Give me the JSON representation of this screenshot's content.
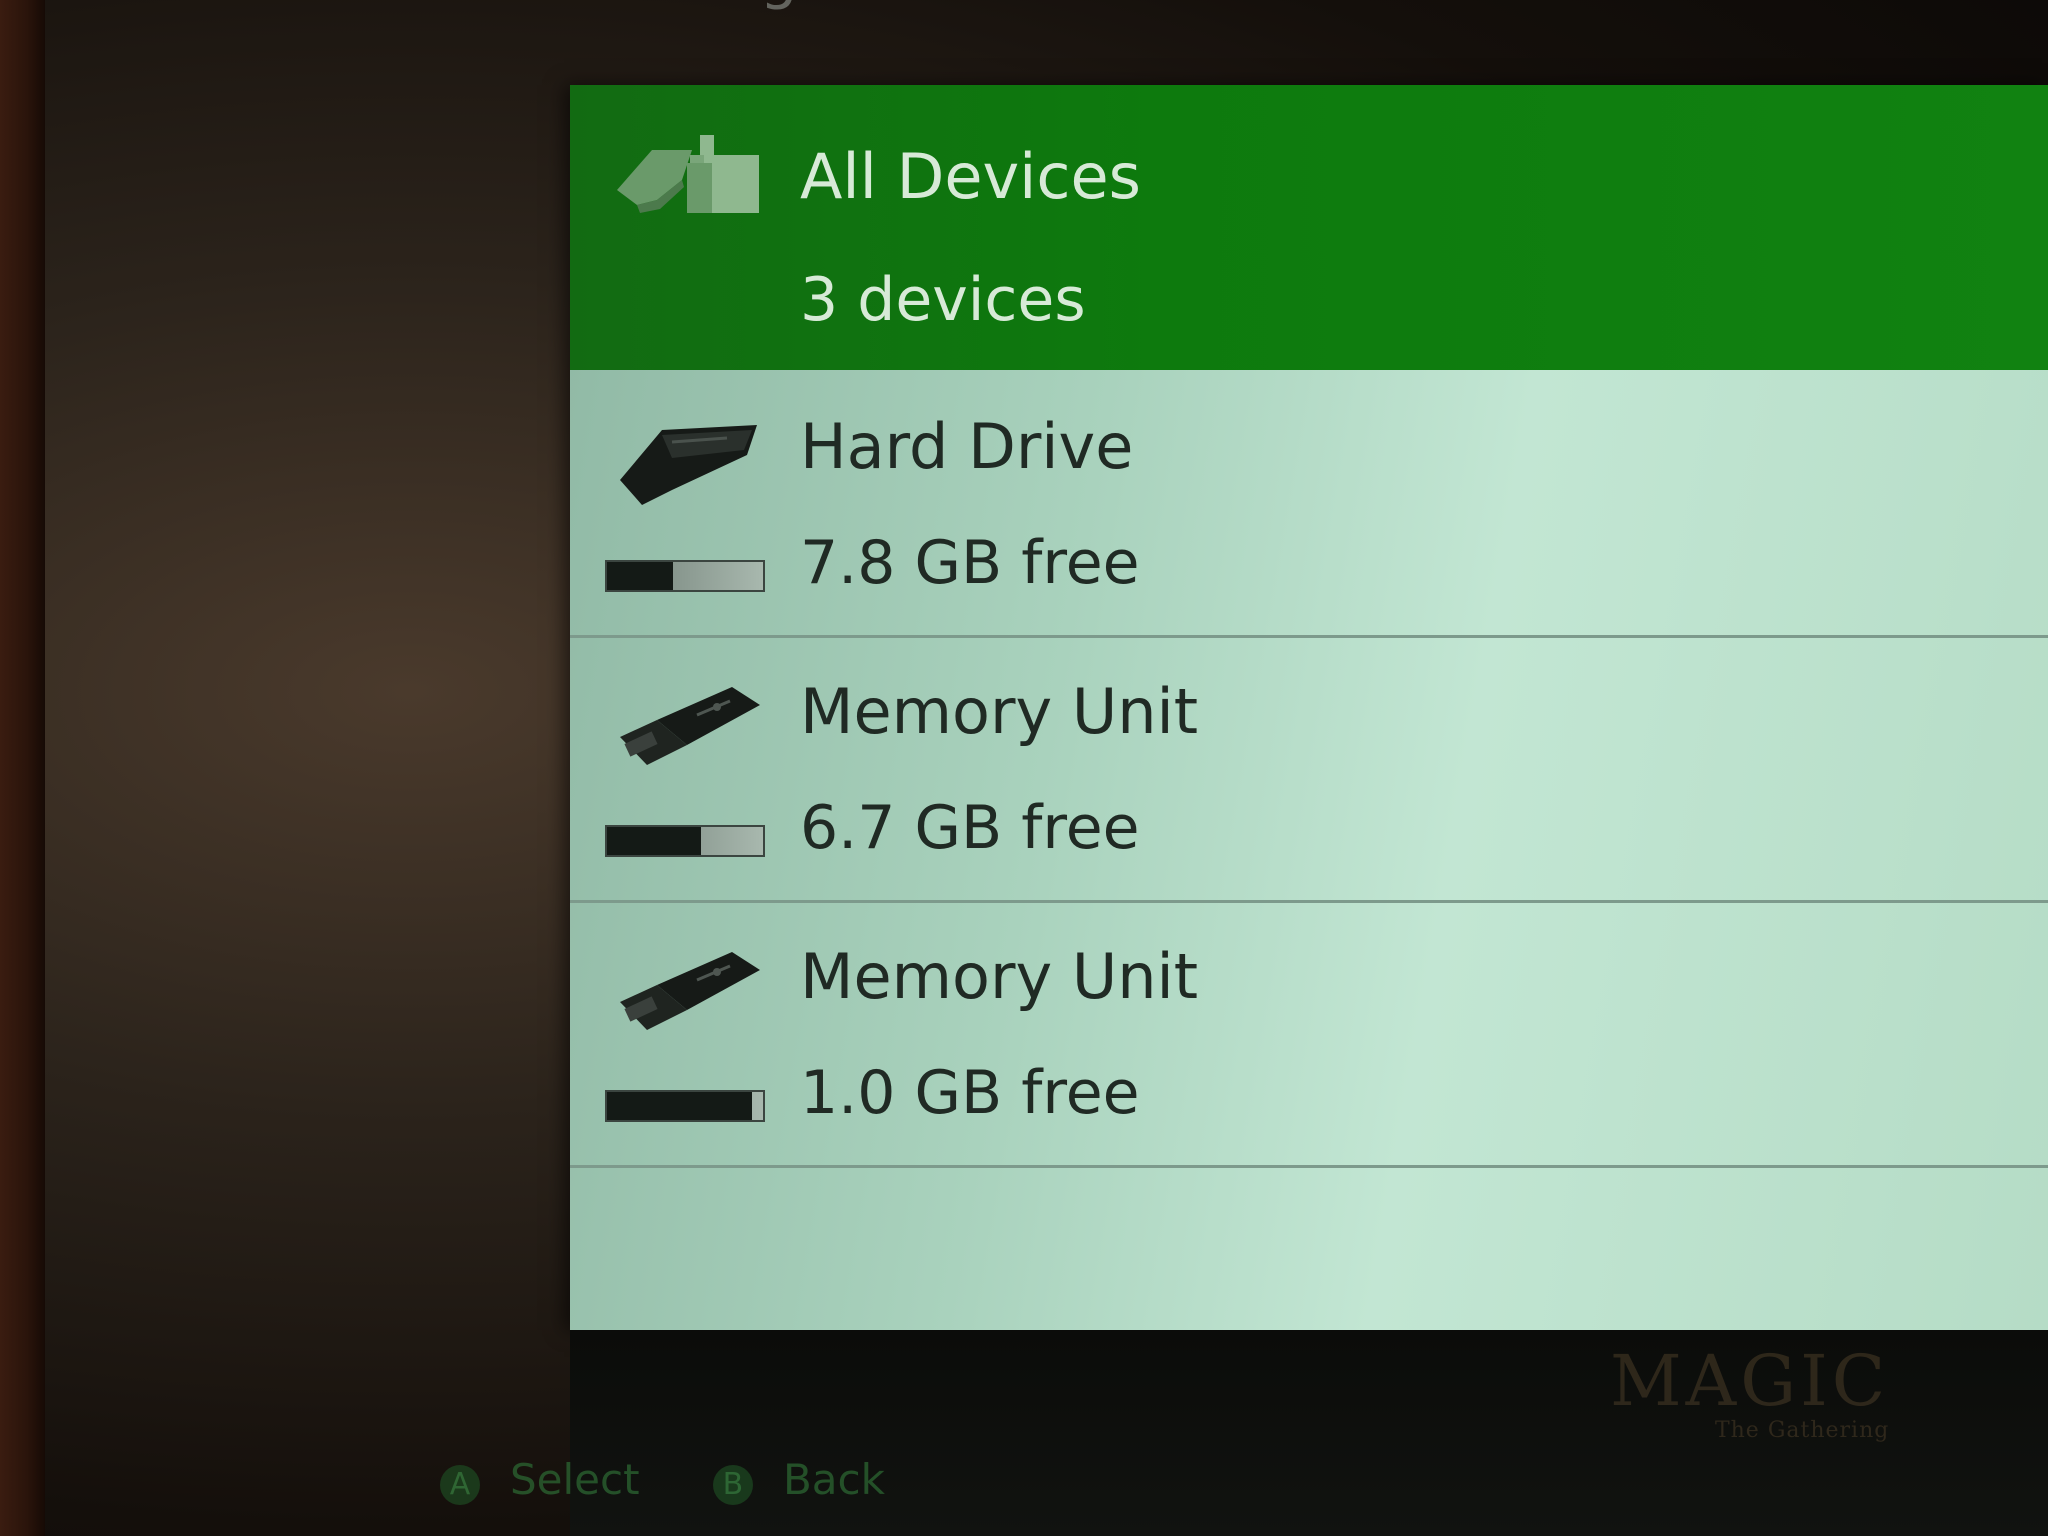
{
  "page": {
    "title": "Storage Devices"
  },
  "header": {
    "icon": "all-devices-icon",
    "title": "All Devices",
    "subtitle": "3 devices"
  },
  "devices": [
    {
      "icon": "hard-drive-icon",
      "name": "Hard Drive",
      "free": "7.8 GB free",
      "used_fraction": 0.42
    },
    {
      "icon": "usb-memory-unit-icon",
      "name": "Memory Unit",
      "free": "6.7 GB free",
      "used_fraction": 0.6
    },
    {
      "icon": "usb-memory-unit-icon",
      "name": "Memory Unit",
      "free": "1.0 GB free",
      "used_fraction": 0.93
    }
  ],
  "footer": {
    "a_button": "A",
    "select_label": "Select",
    "b_button": "B",
    "back_label": "Back"
  },
  "background_ad": {
    "logo": "MAGIC",
    "tagline": "The Gathering"
  },
  "colors": {
    "header_green": "#0d7a0d",
    "list_background": "#b5dcc6",
    "text_dark": "#202a24"
  }
}
